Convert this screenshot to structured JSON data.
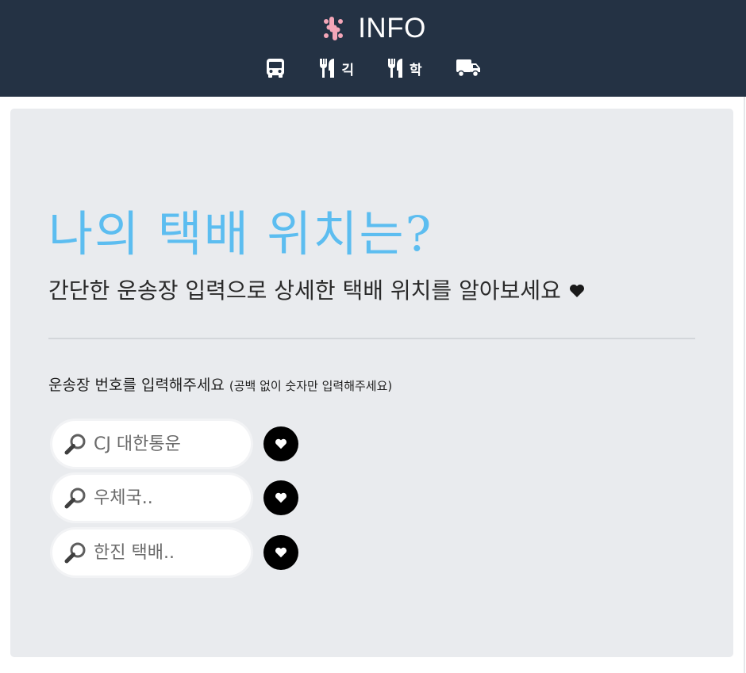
{
  "header": {
    "brand_text": "INFO",
    "brand_icon": "slack-logo-icon",
    "brand_color": "#f4a6b8",
    "nav": [
      {
        "icon": "bus-icon",
        "label": ""
      },
      {
        "icon": "utensils-icon",
        "label": "긱"
      },
      {
        "icon": "utensils-icon",
        "label": "학"
      },
      {
        "icon": "truck-icon",
        "label": ""
      }
    ]
  },
  "main": {
    "title": "나의 택배 위치는?",
    "subtitle": "간단한 운송장 입력으로 상세한 택배 위치를 알아보세요",
    "prompt": "운송장 번호를 입력해주세요",
    "prompt_note": "(공백 없이 숫자만 입력해주세요)",
    "carriers": [
      {
        "placeholder": "CJ 대한통운",
        "value": ""
      },
      {
        "placeholder": "우체국..",
        "value": ""
      },
      {
        "placeholder": "한진 택배..",
        "value": ""
      }
    ]
  },
  "colors": {
    "navbar_bg": "#243244",
    "title": "#5cbdf0",
    "panel_bg": "#e9ebee"
  }
}
